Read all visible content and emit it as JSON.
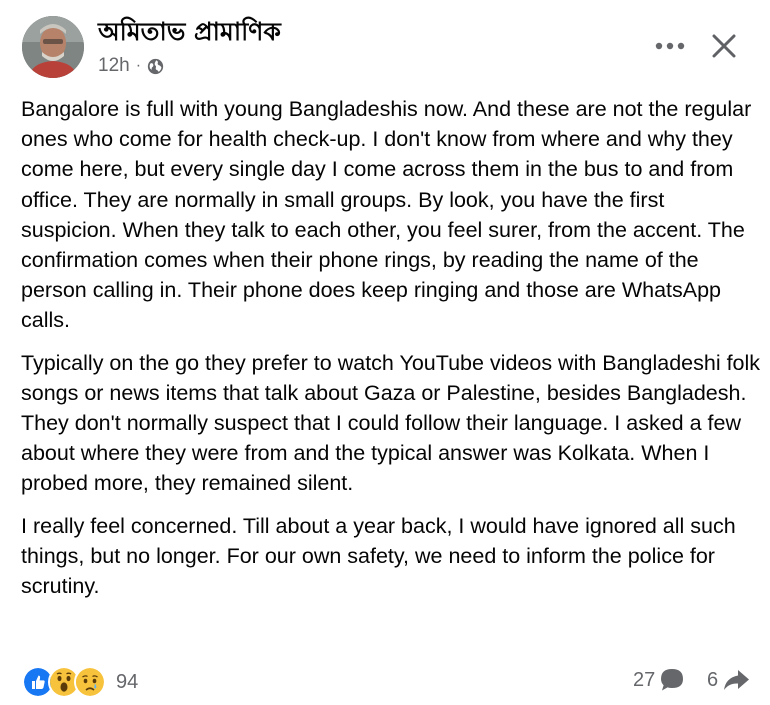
{
  "post": {
    "author": "অমিতাভ প্রামাণিক",
    "time": "12h",
    "paragraphs": [
      "Bangalore is full with young Bangladeshis now. And these are not the regular ones who come for health check-up. I don't know from where and why they come here, but every single day I come across them in the bus to and from office. They are normally in small groups. By look, you have the first suspicion. When they talk to each other, you feel surer, from the accent. The confirmation comes when their phone rings, by reading the name of the person calling in. Their phone does keep ringing and those are WhatsApp calls.",
      "Typically on the go they prefer to watch YouTube videos with Bangladeshi folk songs or news items that talk about Gaza or Palestine, besides Bangladesh. They don't normally suspect that I could follow their language. I asked a few about where they were from and the typical answer was Kolkata. When I probed more, they remained silent.",
      "I really feel concerned. Till about a year back, I would have ignored all such things, but no longer. For our own safety, we need to inform the police for scrutiny."
    ]
  },
  "footer": {
    "reaction_count": "94",
    "comment_count": "27",
    "share_count": "6",
    "reactions": [
      "like-icon",
      "wow-icon",
      "sad-icon"
    ]
  },
  "icons": {
    "audience": "globe-icon",
    "more": "more-options-icon",
    "close": "close-icon",
    "comment": "comment-icon",
    "share": "share-icon"
  },
  "colors": {
    "like_blue": "#1877f2",
    "emoji_yellow": "#f7c23c",
    "secondary_text": "#65676b"
  }
}
